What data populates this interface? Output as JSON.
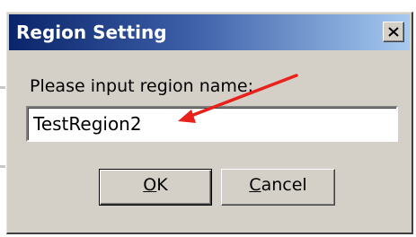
{
  "window": {
    "title": "Region Setting",
    "close_icon": "close-x-icon"
  },
  "dialog": {
    "prompt": "Please input region name:",
    "input_value": "TestRegion2"
  },
  "buttons": {
    "ok_mnemonic": "O",
    "ok_rest": "K",
    "cancel_mnemonic": "C",
    "cancel_rest": "ancel"
  },
  "annotation": {
    "arrow_icon": "red-arrow-icon",
    "color": "#e8211c"
  },
  "colors": {
    "titlebar_start": "#0a246a",
    "titlebar_end": "#a6caf0",
    "dialog_face": "#d4d0c8"
  }
}
